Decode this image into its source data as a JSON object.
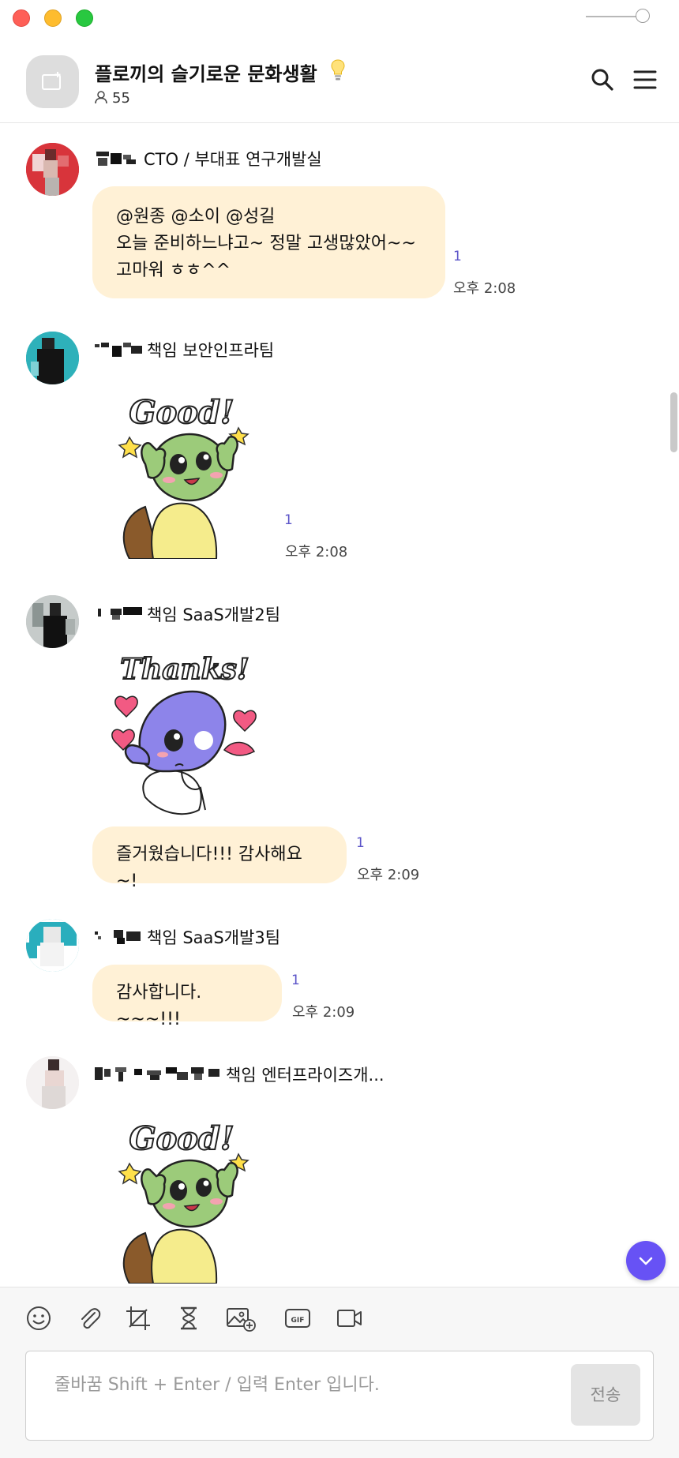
{
  "header": {
    "room_title": "플로끼의 슬기로운 문화생활",
    "member_count": "55"
  },
  "messages": [
    {
      "name_suffix": "CTO / 부대표  연구개발실",
      "lines": [
        "@원종 @소이 @성길",
        "오늘 준비하느냐고~ 정말 고생많았어~~",
        "고마워 ㅎㅎ^^"
      ],
      "unread": "1",
      "time": "오후 2:08"
    },
    {
      "name_suffix": "책임  보안인프라팀",
      "sticker_text": "Good!",
      "unread": "1",
      "time": "오후 2:08"
    },
    {
      "name_suffix": "책임  SaaS개발2팀",
      "sticker_text": "Thanks!",
      "text": "즐거웠습니다!!! 감사해요~!",
      "unread": "1",
      "time": "오후 2:09"
    },
    {
      "name_suffix": "책임  SaaS개발3팀",
      "text": "감사합니다. ~~~!!!",
      "unread": "1",
      "time": "오후 2:09"
    },
    {
      "name_suffix": "책임  엔터프라이즈개...",
      "sticker_text": "Good!"
    }
  ],
  "composer": {
    "placeholder": "줄바꿈 Shift + Enter / 입력 Enter 입니다.",
    "send_label": "전송",
    "tools": [
      "emoji-icon",
      "attach-icon",
      "crop-icon",
      "timer-icon",
      "image-add-icon",
      "gif-icon",
      "video-icon"
    ]
  },
  "colors": {
    "bubble": "#fff1d6",
    "accent": "#6752f5",
    "read_count": "#5b54c8"
  }
}
